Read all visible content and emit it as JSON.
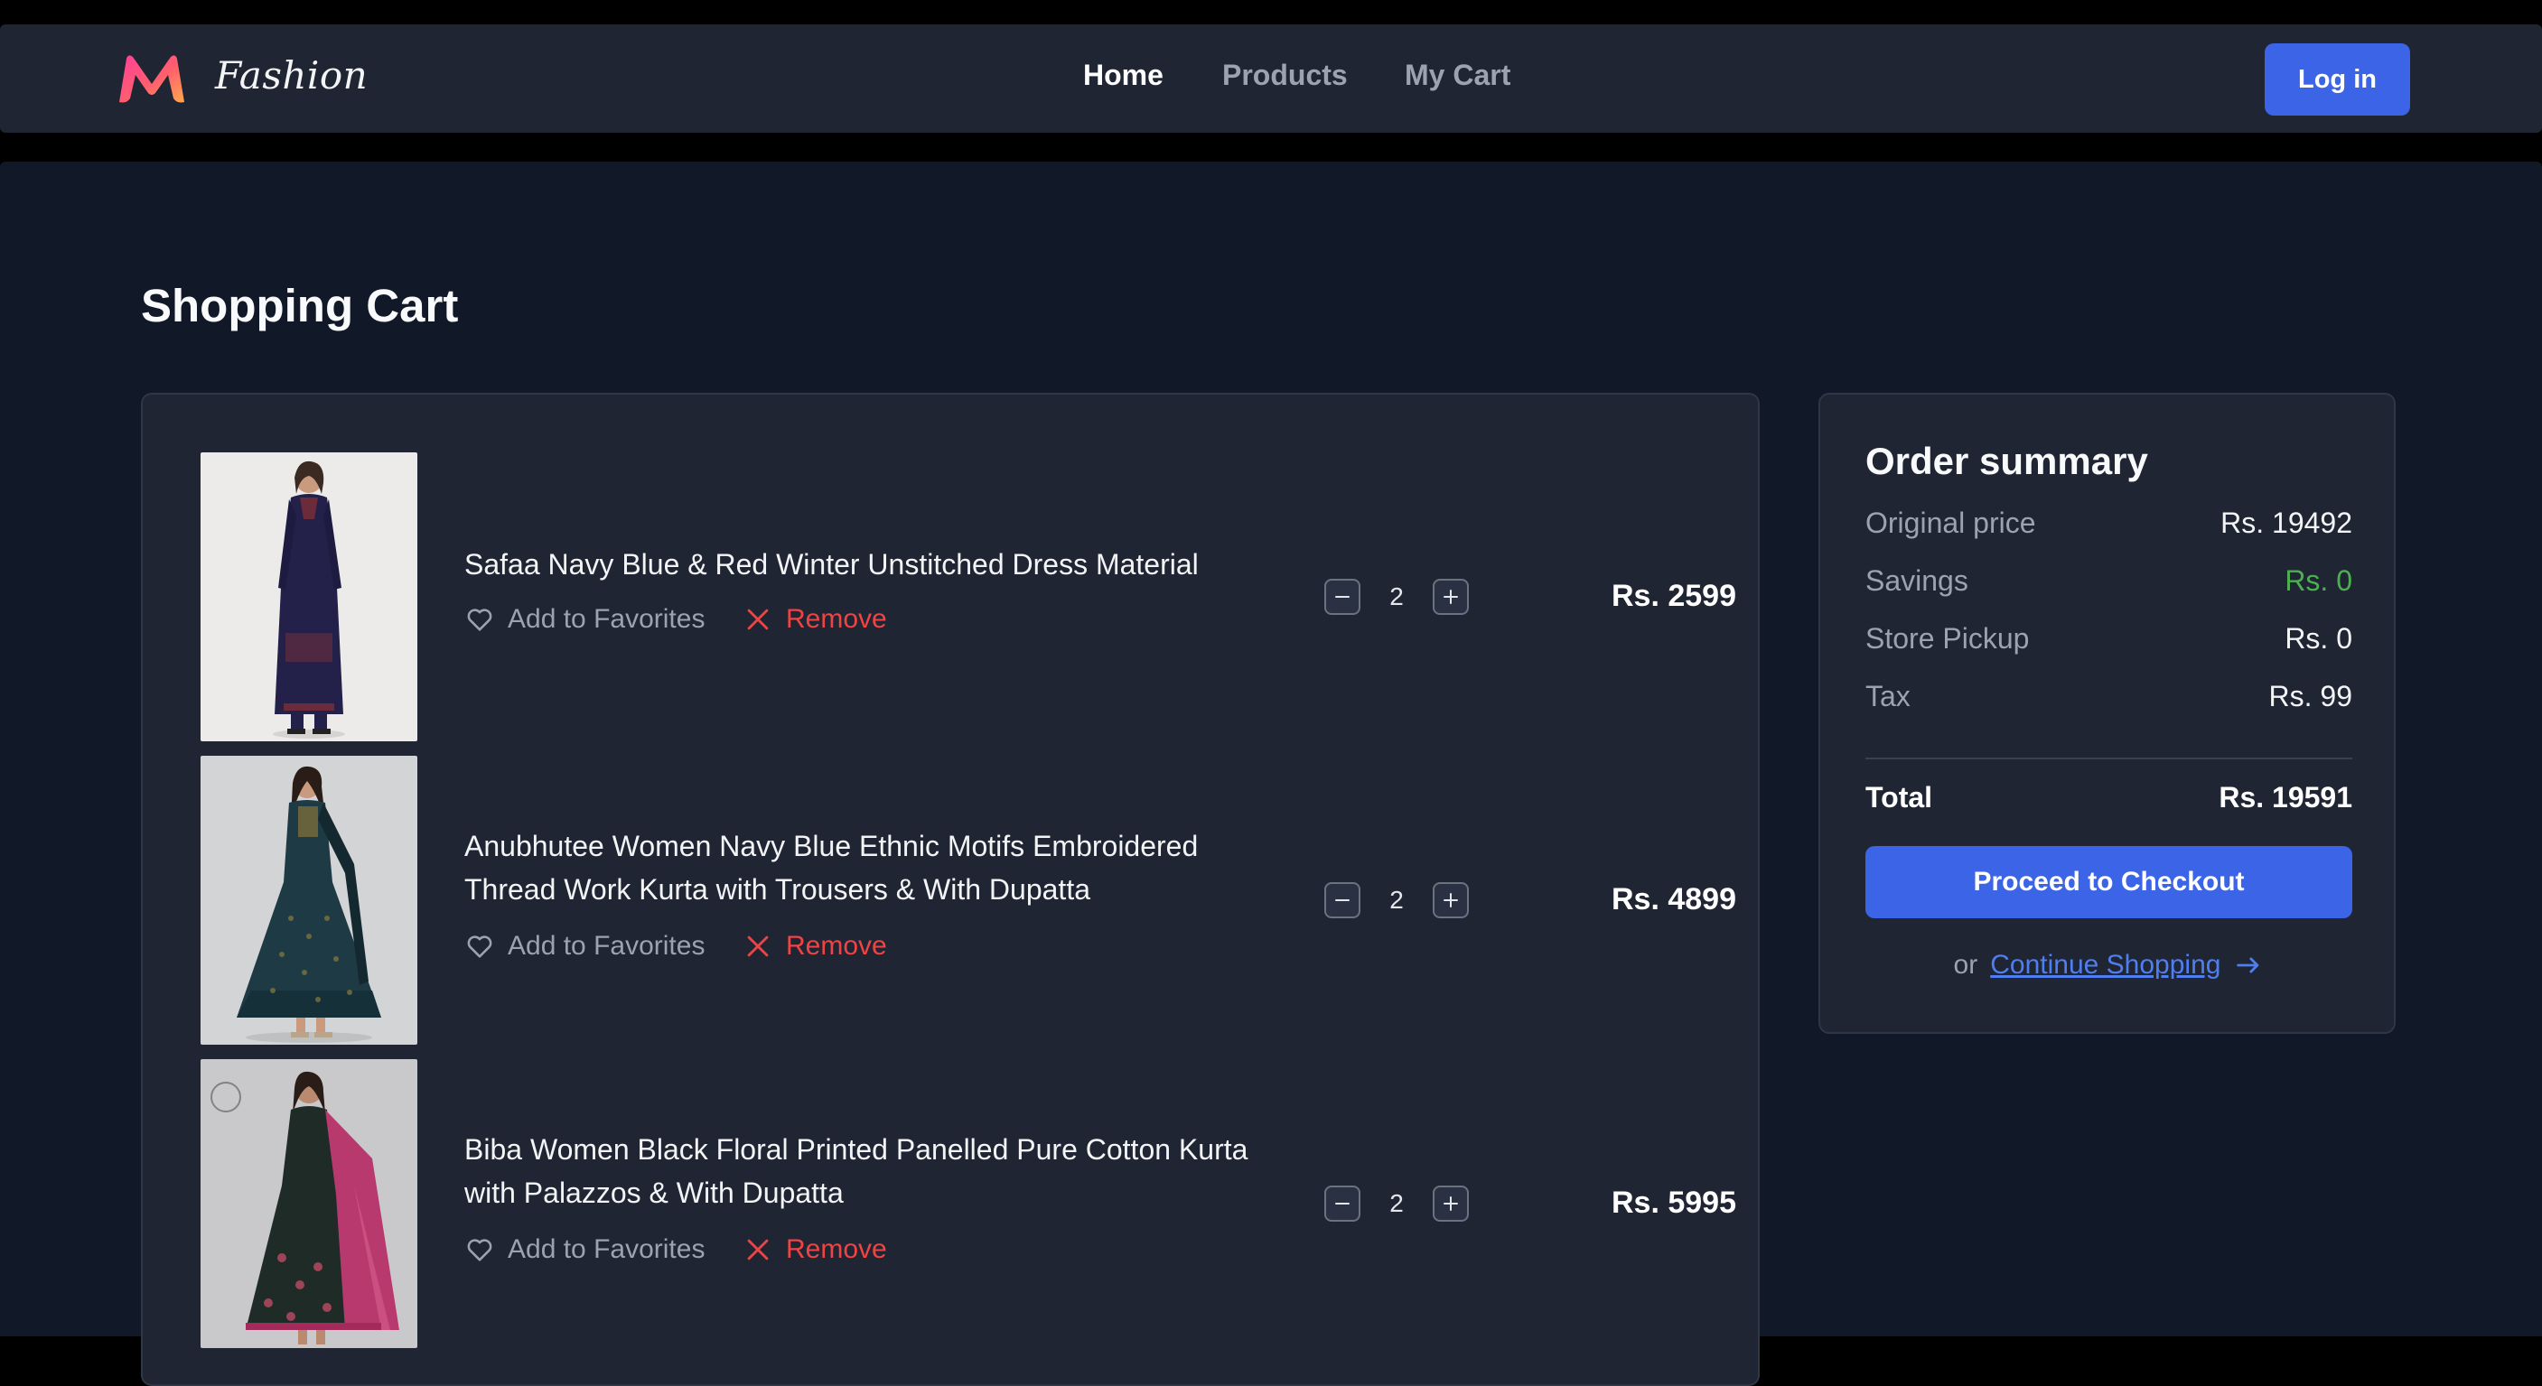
{
  "brand": {
    "name": "Fashion",
    "logo_icon": "m-logo-icon"
  },
  "nav": {
    "links": [
      {
        "label": "Home",
        "active": true
      },
      {
        "label": "Products",
        "active": false
      },
      {
        "label": "My Cart",
        "active": false
      }
    ],
    "login_label": "Log in"
  },
  "cart": {
    "title": "Shopping Cart",
    "items": [
      {
        "title": "Safaa Navy Blue & Red Winter Unstitched Dress Material",
        "quantity": "2",
        "price": "Rs. 2599",
        "favorite_label": "Add to Favorites",
        "remove_label": "Remove"
      },
      {
        "title": "Anubhutee Women Navy Blue Ethnic Motifs Embroidered Thread Work Kurta with Trousers & With Dupatta",
        "quantity": "2",
        "price": "Rs. 4899",
        "favorite_label": "Add to Favorites",
        "remove_label": "Remove"
      },
      {
        "title": "Biba Women Black Floral Printed Panelled Pure Cotton Kurta with Palazzos & With Dupatta",
        "quantity": "2",
        "price": "Rs. 5995",
        "favorite_label": "Add to Favorites",
        "remove_label": "Remove"
      }
    ]
  },
  "summary": {
    "title": "Order summary",
    "rows": [
      {
        "label": "Original price",
        "value": "Rs. 19492"
      },
      {
        "label": "Savings",
        "value": "Rs. 0"
      },
      {
        "label": "Store Pickup",
        "value": "Rs. 0"
      },
      {
        "label": "Tax",
        "value": "Rs. 99"
      }
    ],
    "total_label": "Total",
    "total_value": "Rs. 19591",
    "checkout_label": "Proceed to Checkout",
    "or_label": "or",
    "continue_label": "Continue Shopping"
  },
  "colors": {
    "accent": "#3b65e6",
    "savings": "#4caf50",
    "remove": "#ef4444",
    "background": "#111827",
    "panel": "#1f2533"
  }
}
